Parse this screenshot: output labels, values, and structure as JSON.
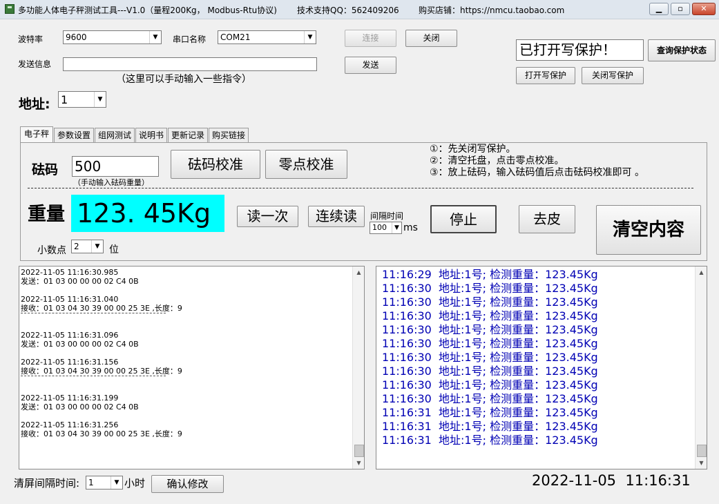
{
  "window": {
    "title": "多功能人体电子秤测试工具---V1.0（量程200Kg， Modbus-Rtu协议)",
    "support_qq": "技术支持QQ：562409206",
    "shop": "购买店铺：https://nmcu.taobao.com"
  },
  "serial": {
    "baud_label": "波特率",
    "baud_value": "9600",
    "port_label": "串口名称",
    "port_value": "COM21",
    "connect_label": "连接",
    "close_label": "关闭",
    "send_label": "发送信息",
    "send_value": "",
    "send_button": "发送",
    "send_hint": "（这里可以手动输入一些指令）"
  },
  "protect": {
    "status": "已打开写保护！",
    "query_button": "查询保护状态",
    "open_button": "打开写保护",
    "close_button": "关闭写保护"
  },
  "address": {
    "label": "地址:",
    "value": "1"
  },
  "tabs": [
    "电子秤",
    "参数设置",
    "组网测试",
    "说明书",
    "更新记录",
    "购买链接"
  ],
  "scale": {
    "weight_code_label": "砝码",
    "weight_code_value": "500",
    "weight_code_hint": "（手动输入砝码重量）",
    "calibrate_button": "砝码校准",
    "zero_button": "零点校准",
    "instructions": [
      "①：先关闭写保护。",
      "②：清空托盘，点击零点校准。",
      "③：放上砝码，输入砝码值后点击砝码校准即可 。"
    ],
    "weight_label": "重量",
    "weight_value": "123. 45Kg",
    "read_once_button": "读一次",
    "read_continuous_button": "连续读",
    "interval_label": "间隔时间",
    "interval_value": "100",
    "interval_unit": "ms",
    "stop_button": "停止",
    "tare_button": "去皮",
    "clear_button": "清空内容",
    "decimal_label": "小数点",
    "decimal_value": "2",
    "decimal_unit": "位"
  },
  "log_left": [
    {
      "time": "2022-11-05 11:16:30.985",
      "text": "发送：01 03 00 00 00 02 C4 0B",
      "divider": false
    },
    {
      "time": "2022-11-05 11:16:31.040",
      "text": "接收：01 03 04 30 39 00 00 25 3E ,长度：9",
      "divider": true
    },
    {
      "time": "2022-11-05 11:16:31.096",
      "text": "发送：01 03 00 00 00 02 C4 0B",
      "divider": false
    },
    {
      "time": "2022-11-05 11:16:31.156",
      "text": "接收：01 03 04 30 39 00 00 25 3E ,长度：9",
      "divider": true
    },
    {
      "time": "2022-11-05 11:16:31.199",
      "text": "发送：01 03 00 00 00 02 C4 0B",
      "divider": false
    },
    {
      "time": "2022-11-05 11:16:31.256",
      "text": "接收：01 03 04 30 39 00 00 25 3E ,长度：9",
      "divider": false
    }
  ],
  "log_right": [
    "11:16:29  地址:1号; 检测重量：123.45Kg",
    "11:16:30  地址:1号; 检测重量：123.45Kg",
    "11:16:30  地址:1号; 检测重量：123.45Kg",
    "11:16:30  地址:1号; 检测重量：123.45Kg",
    "11:16:30  地址:1号; 检测重量：123.45Kg",
    "11:16:30  地址:1号; 检测重量：123.45Kg",
    "11:16:30  地址:1号; 检测重量：123.45Kg",
    "11:16:30  地址:1号; 检测重量：123.45Kg",
    "11:16:30  地址:1号; 检测重量：123.45Kg",
    "11:16:30  地址:1号; 检测重量：123.45Kg",
    "11:16:31  地址:1号; 检测重量：123.45Kg",
    "11:16:31  地址:1号; 检测重量：123.45Kg",
    "11:16:31  地址:1号; 检测重量：123.45Kg"
  ],
  "footer": {
    "clear_interval_label": "清屏间隔时间:",
    "clear_interval_value": "1",
    "clear_interval_unit": "小时",
    "confirm_button": "确认修改",
    "datetime": "2022-11-05  11:16:31"
  },
  "colors": {
    "weight_bg": "#00ffff",
    "log_text": "#0000b4"
  }
}
